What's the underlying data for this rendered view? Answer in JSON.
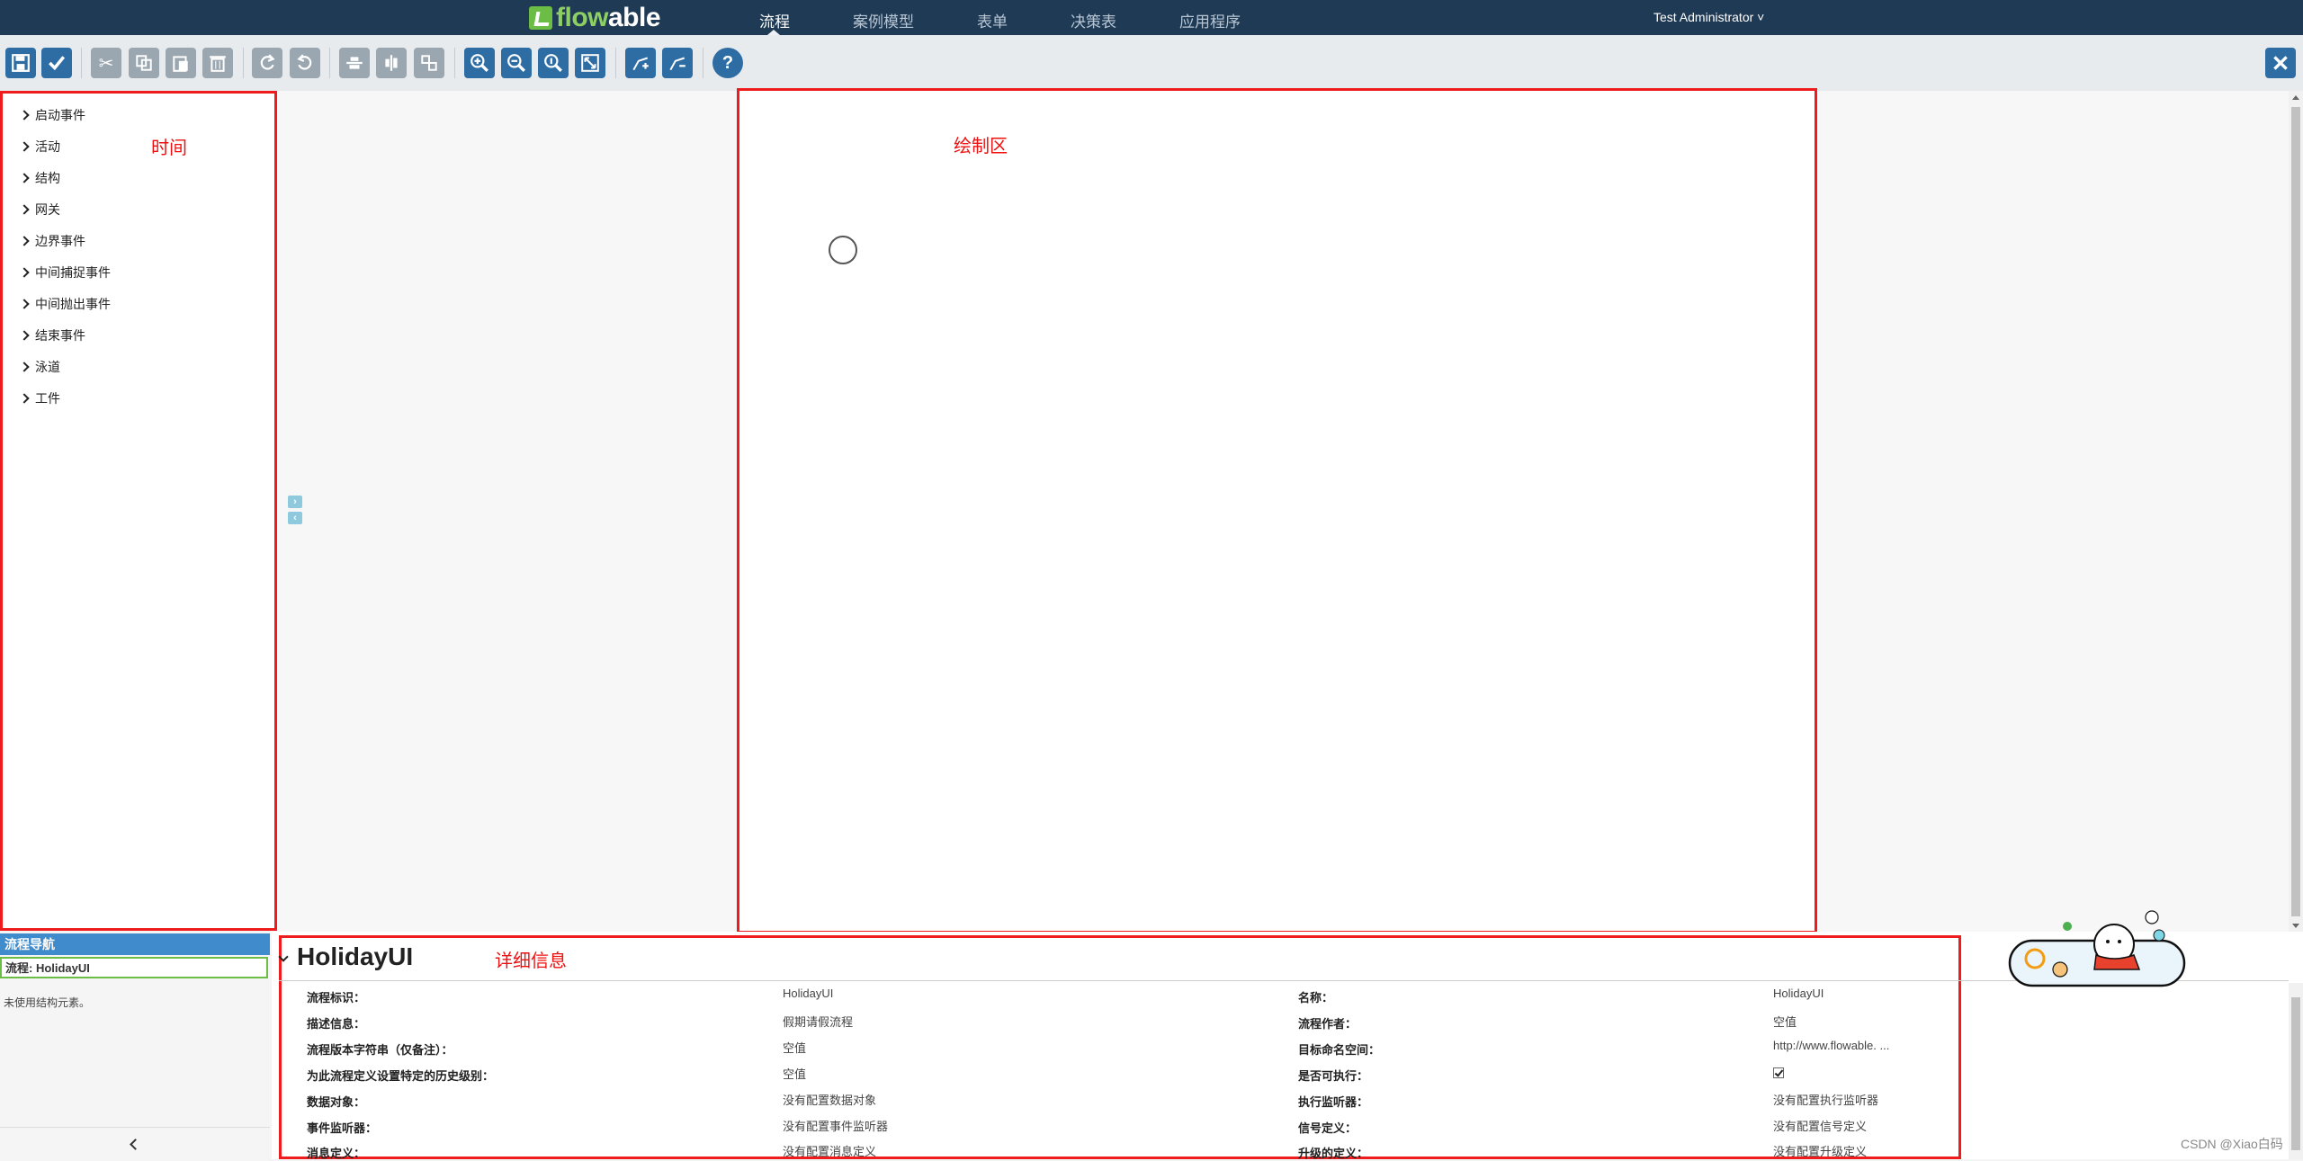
{
  "header": {
    "logo_text_a": "flow",
    "logo_text_b": "able",
    "tabs": [
      {
        "label": "流程",
        "active": true
      },
      {
        "label": "案例模型",
        "active": false
      },
      {
        "label": "表单",
        "active": false
      },
      {
        "label": "决策表",
        "active": false
      },
      {
        "label": "应用程序",
        "active": false
      }
    ],
    "user": "Test Administrator"
  },
  "toolbar": {
    "icons": [
      "save-icon",
      "validate-icon",
      "cut-icon",
      "copy-icon",
      "paste-icon",
      "delete-icon",
      "redo-icon",
      "undo-icon",
      "align-horizontal-icon",
      "align-vertical-icon",
      "same-size-icon",
      "zoom-in-icon",
      "zoom-out-icon",
      "zoom-actual-icon",
      "zoom-fit-icon",
      "bendpoint-add-icon",
      "bendpoint-remove-icon",
      "help-icon",
      "close-icon"
    ]
  },
  "palette": {
    "items": [
      "启动事件",
      "活动",
      "结构",
      "网关",
      "边界事件",
      "中间捕捉事件",
      "中间抛出事件",
      "结束事件",
      "泳道",
      "工件"
    ],
    "annotation": "时间"
  },
  "canvas": {
    "annotation": "绘制区"
  },
  "navigator": {
    "header": "流程导航",
    "process": "流程: HolidayUI",
    "unused": "未使用结构元素。"
  },
  "details": {
    "title": "HolidayUI",
    "annotation": "详细信息",
    "left": [
      {
        "label": "流程标识：",
        "value": "HolidayUI"
      },
      {
        "label": "描述信息：",
        "value": "假期请假流程"
      },
      {
        "label": "流程版本字符串（仅备注）：",
        "value": "空值"
      },
      {
        "label": "为此流程定义设置特定的历史级别：",
        "value": "空值"
      },
      {
        "label": "数据对象：",
        "value": "没有配置数据对象"
      },
      {
        "label": "事件监听器：",
        "value": "没有配置事件监听器"
      },
      {
        "label": "消息定义：",
        "value": "没有配置消息定义"
      }
    ],
    "right": [
      {
        "label": "名称：",
        "value": "HolidayUI"
      },
      {
        "label": "流程作者：",
        "value": "空值"
      },
      {
        "label": "目标命名空间：",
        "value": "http://www.flowable. ..."
      },
      {
        "label": "是否可执行：",
        "value": ""
      },
      {
        "label": "执行监听器：",
        "value": "没有配置执行监听器"
      },
      {
        "label": "信号定义：",
        "value": "没有配置信号定义"
      },
      {
        "label": "升级的定义：",
        "value": "没有配置升级定义"
      }
    ],
    "is_executable": true
  },
  "watermark": "CSDN @Xiao白码"
}
